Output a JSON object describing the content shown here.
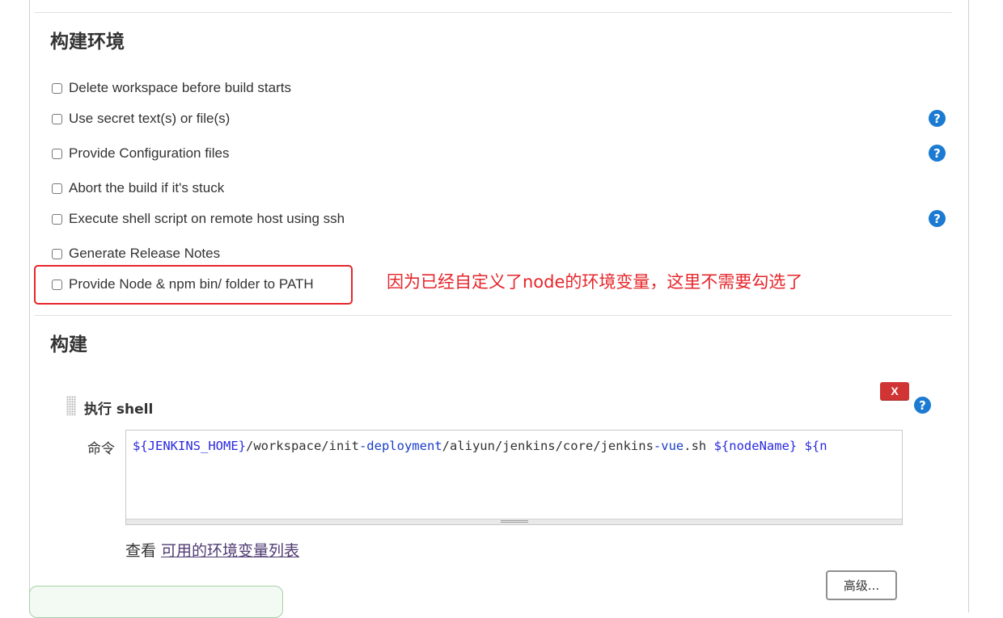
{
  "build_env": {
    "title": "构建环境",
    "options": [
      {
        "label": "Delete workspace before build starts",
        "checked": false,
        "help": false
      },
      {
        "label": "Use secret text(s) or file(s)",
        "checked": false,
        "help": true
      },
      {
        "label": "Provide Configuration files",
        "checked": false,
        "help": true
      },
      {
        "label": "Abort the build if it's stuck",
        "checked": false,
        "help": false
      },
      {
        "label": "Execute shell script on remote host using ssh",
        "checked": false,
        "help": true
      },
      {
        "label": "Generate Release Notes",
        "checked": false,
        "help": false
      },
      {
        "label": "Provide Node & npm bin/ folder to PATH",
        "checked": false,
        "help": false
      }
    ]
  },
  "annotation": {
    "text": "因为已经自定义了node的环境变量，这里不需要勾选了",
    "color": "#e6262b"
  },
  "build": {
    "title": "构建",
    "step": {
      "title": "执行 shell",
      "delete_label": "X",
      "command_label": "命令",
      "command_tokens": [
        {
          "text": "${JENKINS_HOME}",
          "kind": "var"
        },
        {
          "text": "/workspace/init",
          "kind": "plain"
        },
        {
          "text": "-deployment",
          "kind": "kw"
        },
        {
          "text": "/aliyun/jenkins/core/jenkins",
          "kind": "plain"
        },
        {
          "text": "-vue",
          "kind": "kw"
        },
        {
          "text": ".sh ",
          "kind": "plain"
        },
        {
          "text": "${nodeName}",
          "kind": "var"
        },
        {
          "text": " ${n",
          "kind": "var"
        }
      ],
      "env_prefix": "查看 ",
      "env_link": "可用的环境变量列表",
      "advanced_label": "高级..."
    }
  },
  "icons": {
    "help": "help-question-icon",
    "drag": "drag-handle-icon"
  },
  "colors": {
    "help_blue": "#1b7ad1",
    "delete_red": "#d03434"
  }
}
